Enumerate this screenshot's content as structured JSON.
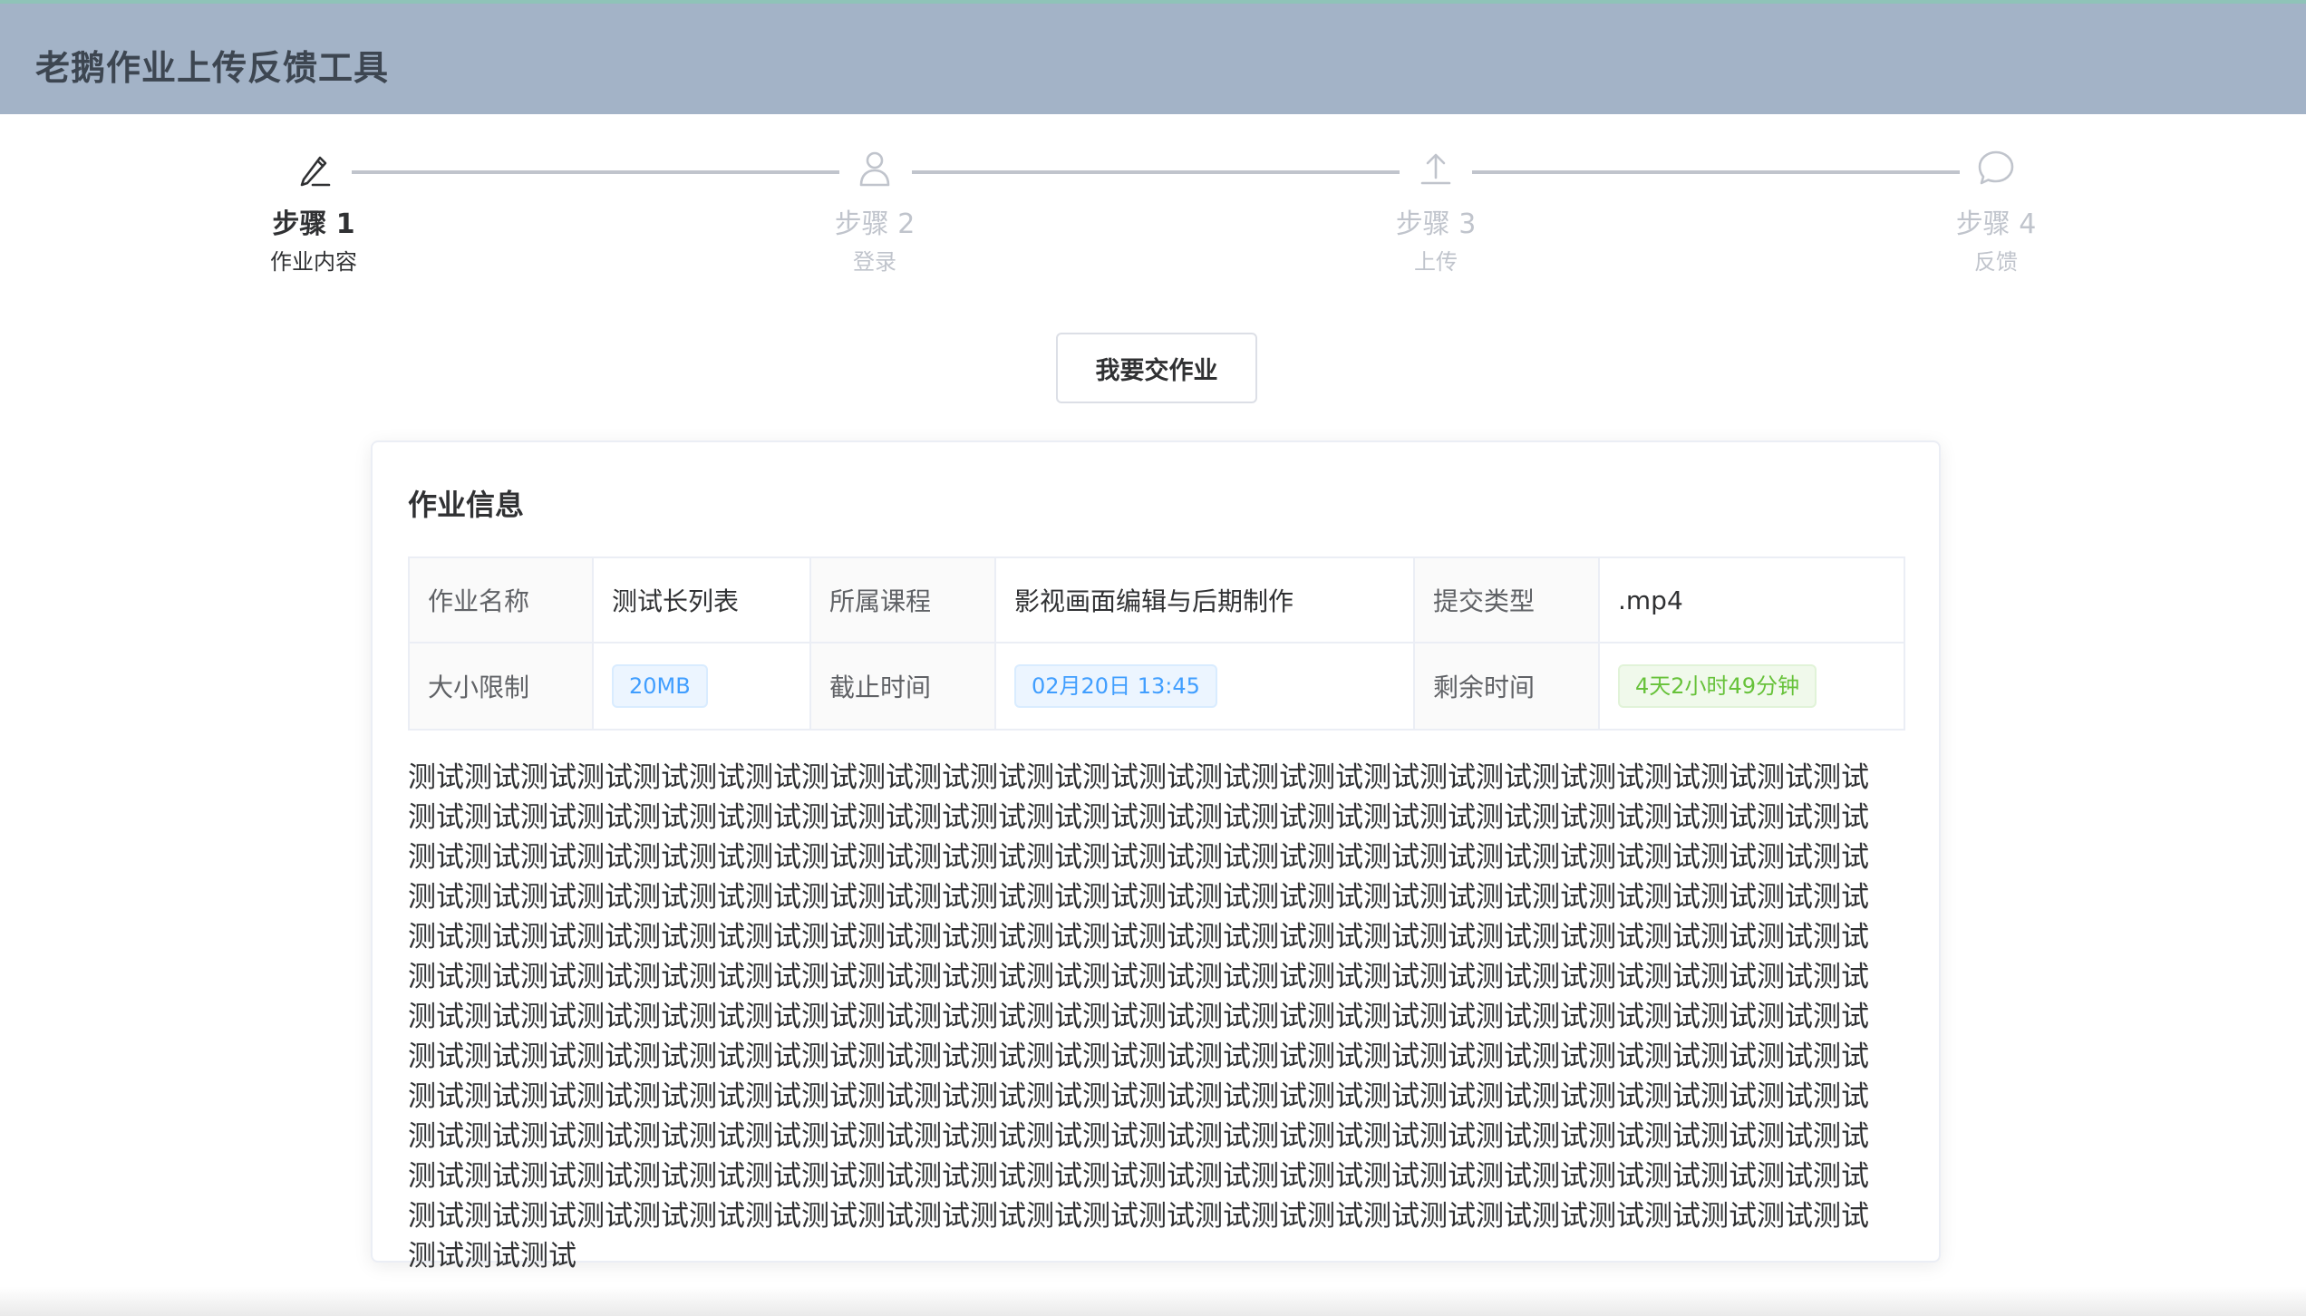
{
  "header": {
    "title": "老鹅作业上传反馈工具"
  },
  "steps": [
    {
      "title": "步骤 1",
      "desc": "作业内容",
      "icon": "edit-icon",
      "status": "active"
    },
    {
      "title": "步骤 2",
      "desc": "登录",
      "icon": "user-icon",
      "status": "wait"
    },
    {
      "title": "步骤 3",
      "desc": "上传",
      "icon": "upload-icon",
      "status": "wait"
    },
    {
      "title": "步骤 4",
      "desc": "反馈",
      "icon": "chat-bubble-icon",
      "status": "wait"
    }
  ],
  "actions": {
    "submit_label": "我要交作业"
  },
  "card": {
    "title": "作业信息",
    "rows": [
      [
        {
          "label": "作业名称",
          "value": "测试长列表"
        },
        {
          "label": "所属课程",
          "value": "影视画面编辑与后期制作"
        },
        {
          "label": "提交类型",
          "value": ".mp4"
        }
      ],
      [
        {
          "label": "大小限制",
          "value": "20MB",
          "tag": "blue"
        },
        {
          "label": "截止时间",
          "value": "02月20日 13:45",
          "tag": "blue"
        },
        {
          "label": "剩余时间",
          "value": "4天2小时49分钟",
          "tag": "green"
        }
      ]
    ],
    "description": "测试测试测试测试测试测试测试测试测试测试测试测试测试测试测试测试测试测试测试测试测试测试测试测试测试测试测试测试测试测试测试测试测试测试测试测试测试测试测试测试测试测试测试测试测试测试测试测试测试测试测试测试测试测试测试测试测试测试测试测试测试测试测试测试测试测试测试测试测试测试测试测试测试测试测试测试测试测试测试测试测试测试测试测试测试测试测试测试测试测试测试测试测试测试测试测试测试测试测试测试测试测试测试测试测试测试测试测试测试测试测试测试测试测试测试测试测试测试测试测试测试测试测试测试测试测试测试测试测试测试测试测试测试测试测试测试测试测试测试测试测试测试测试测试测试测试测试测试测试测试测试测试测试测试测试测试测试测试测试测试测试测试测试测试测试测试测试测试测试测试测试测试测试测试测试测试测试测试测试测试测试测试测试测试测试测试测试测试测试测试测试测试测试测试测试测试测试测试测试测试测试测试测试测试测试测试测试测试测试测试测试测试测试测试测试测试测试测试测试测试测试测试测试测试测试测试测试测试测试测试测试测试测试测试测试测试测试测试测试测试测试测试测试测试测试测试测试测试测试测试测试测试测试测试测试测试测试测试测试测试测试测试测试测试测试测试测试测试测试测试测试测试测试测试测试测试测试测试测试测试测试测试测试测试测试测试测试测试测试测试测试测试测试测试测试测试测试测试测试测试测试测试测试测试测试测试测试测试测试测试测试测试测试测试测试"
  }
}
